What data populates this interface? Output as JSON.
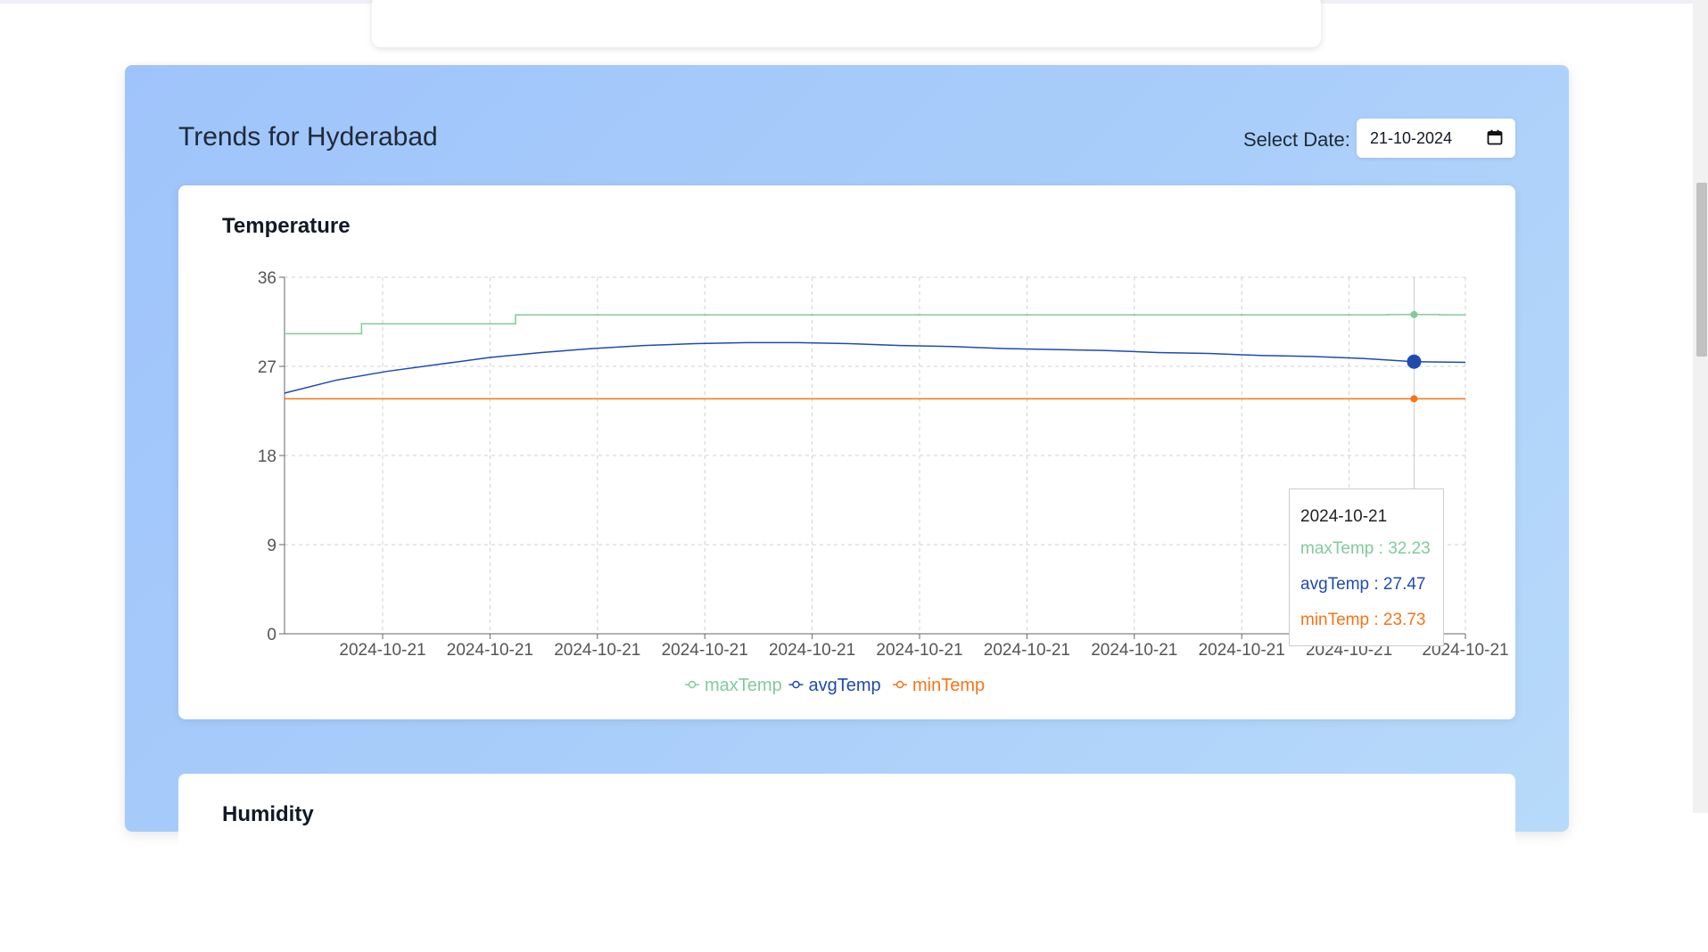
{
  "trends": {
    "title": "Trends for Hyderabad",
    "date_label": "Select Date:",
    "date_value": "21-10-2024"
  },
  "temperature_chart": {
    "title": "Temperature",
    "tooltip": {
      "label": "2024-10-21",
      "rows": [
        "maxTemp : 32.23",
        "avgTemp : 27.47",
        "minTemp : 23.73"
      ]
    }
  },
  "humidity_chart": {
    "title": "Humidity"
  },
  "colors": {
    "maxTemp": "#82ca9d",
    "avgTemp": "#1d4bb0",
    "minTemp": "#f97316"
  },
  "chart_data": {
    "type": "line",
    "title": "Temperature",
    "x": [
      "2024-10-21",
      "2024-10-21",
      "2024-10-21",
      "2024-10-21",
      "2024-10-21",
      "2024-10-21",
      "2024-10-21",
      "2024-10-21",
      "2024-10-21",
      "2024-10-21",
      "2024-10-21",
      "2024-10-21",
      "2024-10-21",
      "2024-10-21",
      "2024-10-21",
      "2024-10-21",
      "2024-10-21",
      "2024-10-21",
      "2024-10-21",
      "2024-10-21",
      "2024-10-21",
      "2024-10-21",
      "2024-10-21",
      "2024-10-21"
    ],
    "x_tick_labels": [
      "2024-10-21",
      "2024-10-21",
      "2024-10-21",
      "2024-10-21",
      "2024-10-21",
      "2024-10-21",
      "2024-10-21",
      "2024-10-21",
      "2024-10-21",
      "2024-10-21",
      "2024-10-21"
    ],
    "y_ticks": [
      0,
      9,
      18,
      27,
      36
    ],
    "ylim": [
      0,
      36
    ],
    "grid": true,
    "legend": "bottom-center",
    "series": [
      {
        "name": "maxTemp",
        "values": [
          30.3,
          30.3,
          31.3,
          31.3,
          31.3,
          32.2,
          32.2,
          32.2,
          32.2,
          32.2,
          32.2,
          32.2,
          32.2,
          32.2,
          32.2,
          32.2,
          32.2,
          32.2,
          32.2,
          32.2,
          32.2,
          32.2,
          32.23,
          32.2
        ]
      },
      {
        "name": "avgTemp",
        "values": [
          24.3,
          25.6,
          26.5,
          27.2,
          27.9,
          28.4,
          28.8,
          29.1,
          29.3,
          29.4,
          29.4,
          29.3,
          29.1,
          29.0,
          28.8,
          28.7,
          28.6,
          28.4,
          28.3,
          28.1,
          28.0,
          27.8,
          27.47,
          27.4
        ]
      },
      {
        "name": "minTemp",
        "values": [
          23.73,
          23.73,
          23.73,
          23.73,
          23.73,
          23.73,
          23.73,
          23.73,
          23.73,
          23.73,
          23.73,
          23.73,
          23.73,
          23.73,
          23.73,
          23.73,
          23.73,
          23.73,
          23.73,
          23.73,
          23.73,
          23.73,
          23.73,
          23.73
        ]
      }
    ],
    "active_point": {
      "x": "2024-10-21",
      "maxTemp": 32.23,
      "avgTemp": 27.47,
      "minTemp": 23.73
    }
  }
}
